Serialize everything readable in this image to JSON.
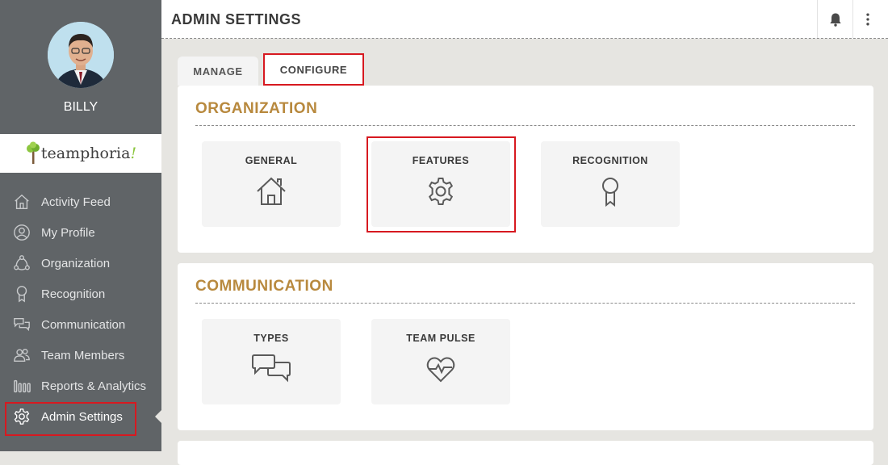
{
  "user": {
    "name": "BILLY"
  },
  "brand": {
    "name": "teamphoria",
    "suffix": "!"
  },
  "nav": {
    "items": [
      {
        "label": "Activity Feed",
        "icon": "home-icon"
      },
      {
        "label": "My Profile",
        "icon": "user-circle-icon"
      },
      {
        "label": "Organization",
        "icon": "organization-icon"
      },
      {
        "label": "Recognition",
        "icon": "ribbon-icon"
      },
      {
        "label": "Communication",
        "icon": "chat-icon"
      },
      {
        "label": "Team Members",
        "icon": "users-icon"
      },
      {
        "label": "Reports & Analytics",
        "icon": "bar-chart-icon"
      },
      {
        "label": "Admin Settings",
        "icon": "gear-icon",
        "active": true
      }
    ]
  },
  "header": {
    "title": "ADMIN SETTINGS"
  },
  "tabs": [
    {
      "label": "MANAGE",
      "active": false
    },
    {
      "label": "CONFIGURE",
      "active": true
    }
  ],
  "sections": {
    "organization": {
      "title": "ORGANIZATION",
      "tiles": [
        {
          "label": "GENERAL",
          "icon": "house-icon"
        },
        {
          "label": "FEATURES",
          "icon": "gear-icon"
        },
        {
          "label": "RECOGNITION",
          "icon": "ribbon-icon"
        }
      ]
    },
    "communication": {
      "title": "COMMUNICATION",
      "tiles": [
        {
          "label": "TYPES",
          "icon": "chat-bubbles-icon"
        },
        {
          "label": "TEAM PULSE",
          "icon": "heart-pulse-icon"
        }
      ]
    }
  },
  "colors": {
    "accent": "#b8893e",
    "highlight": "#d71920",
    "sidebar": "#606467",
    "background": "#e6e5e1"
  }
}
